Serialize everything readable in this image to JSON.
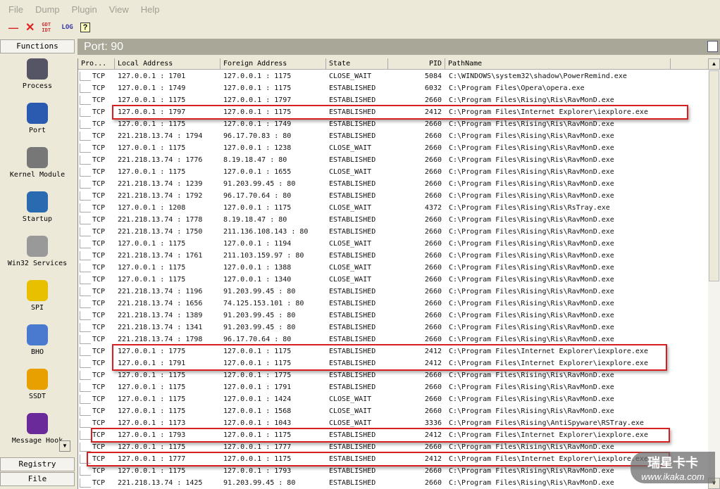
{
  "menu": [
    "File",
    "Dump",
    "Plugin",
    "View",
    "Help"
  ],
  "toolbar": {
    "minimize": "—",
    "close": "✕",
    "gdt_idt": "GDT IDT",
    "log": "LOG",
    "help": "?"
  },
  "sidebar": {
    "header": "Functions",
    "items": [
      "Process",
      "Port",
      "Kernel Module",
      "Startup",
      "Win32 Services",
      "SPI",
      "BHO",
      "SSDT",
      "Message Hook"
    ],
    "bottom": [
      "Registry",
      "File"
    ]
  },
  "title": "Port: 90",
  "columns": [
    "Pro...",
    "Local Address",
    "Foreign Address",
    "State",
    "PID",
    "PathName"
  ],
  "rows": [
    [
      "TCP",
      "127.0.0.1 : 1701",
      "127.0.0.1 : 1175",
      "CLOSE_WAIT",
      "5084",
      "C:\\WINDOWS\\system32\\shadow\\PowerRemind.exe"
    ],
    [
      "TCP",
      "127.0.0.1 : 1749",
      "127.0.0.1 : 1175",
      "ESTABLISHED",
      "6032",
      "C:\\Program Files\\Opera\\opera.exe"
    ],
    [
      "TCP",
      "127.0.0.1 : 1175",
      "127.0.0.1 : 1797",
      "ESTABLISHED",
      "2660",
      "C:\\Program Files\\Rising\\Ris\\RavMonD.exe"
    ],
    [
      "TCP",
      "127.0.0.1 : 1797",
      "127.0.0.1 : 1175",
      "ESTABLISHED",
      "2412",
      "C:\\Program Files\\Internet Explorer\\iexplore.exe"
    ],
    [
      "TCP",
      "127.0.0.1 : 1175",
      "127.0.0.1 : 1749",
      "ESTABLISHED",
      "2660",
      "C:\\Program Files\\Rising\\Ris\\RavMonD.exe"
    ],
    [
      "TCP",
      "221.218.13.74 : 1794",
      "96.17.70.83 : 80",
      "ESTABLISHED",
      "2660",
      "C:\\Program Files\\Rising\\Ris\\RavMonD.exe"
    ],
    [
      "TCP",
      "127.0.0.1 : 1175",
      "127.0.0.1 : 1238",
      "CLOSE_WAIT",
      "2660",
      "C:\\Program Files\\Rising\\Ris\\RavMonD.exe"
    ],
    [
      "TCP",
      "221.218.13.74 : 1776",
      "8.19.18.47 : 80",
      "ESTABLISHED",
      "2660",
      "C:\\Program Files\\Rising\\Ris\\RavMonD.exe"
    ],
    [
      "TCP",
      "127.0.0.1 : 1175",
      "127.0.0.1 : 1655",
      "CLOSE_WAIT",
      "2660",
      "C:\\Program Files\\Rising\\Ris\\RavMonD.exe"
    ],
    [
      "TCP",
      "221.218.13.74 : 1239",
      "91.203.99.45 : 80",
      "ESTABLISHED",
      "2660",
      "C:\\Program Files\\Rising\\Ris\\RavMonD.exe"
    ],
    [
      "TCP",
      "221.218.13.74 : 1792",
      "96.17.70.64 : 80",
      "ESTABLISHED",
      "2660",
      "C:\\Program Files\\Rising\\Ris\\RavMonD.exe"
    ],
    [
      "TCP",
      "127.0.0.1 : 1208",
      "127.0.0.1 : 1175",
      "CLOSE_WAIT",
      "4372",
      "C:\\Program Files\\Rising\\Ris\\RsTray.exe"
    ],
    [
      "TCP",
      "221.218.13.74 : 1778",
      "8.19.18.47 : 80",
      "ESTABLISHED",
      "2660",
      "C:\\Program Files\\Rising\\Ris\\RavMonD.exe"
    ],
    [
      "TCP",
      "221.218.13.74 : 1750",
      "211.136.108.143 : 80",
      "ESTABLISHED",
      "2660",
      "C:\\Program Files\\Rising\\Ris\\RavMonD.exe"
    ],
    [
      "TCP",
      "127.0.0.1 : 1175",
      "127.0.0.1 : 1194",
      "CLOSE_WAIT",
      "2660",
      "C:\\Program Files\\Rising\\Ris\\RavMonD.exe"
    ],
    [
      "TCP",
      "221.218.13.74 : 1761",
      "211.103.159.97 : 80",
      "ESTABLISHED",
      "2660",
      "C:\\Program Files\\Rising\\Ris\\RavMonD.exe"
    ],
    [
      "TCP",
      "127.0.0.1 : 1175",
      "127.0.0.1 : 1388",
      "CLOSE_WAIT",
      "2660",
      "C:\\Program Files\\Rising\\Ris\\RavMonD.exe"
    ],
    [
      "TCP",
      "127.0.0.1 : 1175",
      "127.0.0.1 : 1340",
      "CLOSE_WAIT",
      "2660",
      "C:\\Program Files\\Rising\\Ris\\RavMonD.exe"
    ],
    [
      "TCP",
      "221.218.13.74 : 1196",
      "91.203.99.45 : 80",
      "ESTABLISHED",
      "2660",
      "C:\\Program Files\\Rising\\Ris\\RavMonD.exe"
    ],
    [
      "TCP",
      "221.218.13.74 : 1656",
      "74.125.153.101 : 80",
      "ESTABLISHED",
      "2660",
      "C:\\Program Files\\Rising\\Ris\\RavMonD.exe"
    ],
    [
      "TCP",
      "221.218.13.74 : 1389",
      "91.203.99.45 : 80",
      "ESTABLISHED",
      "2660",
      "C:\\Program Files\\Rising\\Ris\\RavMonD.exe"
    ],
    [
      "TCP",
      "221.218.13.74 : 1341",
      "91.203.99.45 : 80",
      "ESTABLISHED",
      "2660",
      "C:\\Program Files\\Rising\\Ris\\RavMonD.exe"
    ],
    [
      "TCP",
      "221.218.13.74 : 1798",
      "96.17.70.64 : 80",
      "ESTABLISHED",
      "2660",
      "C:\\Program Files\\Rising\\Ris\\RavMonD.exe"
    ],
    [
      "TCP",
      "127.0.0.1 : 1775",
      "127.0.0.1 : 1175",
      "ESTABLISHED",
      "2412",
      "C:\\Program Files\\Internet Explorer\\iexplore.exe"
    ],
    [
      "TCP",
      "127.0.0.1 : 1791",
      "127.0.0.1 : 1175",
      "ESTABLISHED",
      "2412",
      "C:\\Program Files\\Internet Explorer\\iexplore.exe"
    ],
    [
      "TCP",
      "127.0.0.1 : 1175",
      "127.0.0.1 : 1775",
      "ESTABLISHED",
      "2660",
      "C:\\Program Files\\Rising\\Ris\\RavMonD.exe"
    ],
    [
      "TCP",
      "127.0.0.1 : 1175",
      "127.0.0.1 : 1791",
      "ESTABLISHED",
      "2660",
      "C:\\Program Files\\Rising\\Ris\\RavMonD.exe"
    ],
    [
      "TCP",
      "127.0.0.1 : 1175",
      "127.0.0.1 : 1424",
      "CLOSE_WAIT",
      "2660",
      "C:\\Program Files\\Rising\\Ris\\RavMonD.exe"
    ],
    [
      "TCP",
      "127.0.0.1 : 1175",
      "127.0.0.1 : 1568",
      "CLOSE_WAIT",
      "2660",
      "C:\\Program Files\\Rising\\Ris\\RavMonD.exe"
    ],
    [
      "TCP",
      "127.0.0.1 : 1173",
      "127.0.0.1 : 1043",
      "CLOSE_WAIT",
      "3336",
      "C:\\Program Files\\Rising\\AntiSpyware\\RSTray.exe"
    ],
    [
      "TCP",
      "127.0.0.1 : 1793",
      "127.0.0.1 : 1175",
      "ESTABLISHED",
      "2412",
      "C:\\Program Files\\Internet Explorer\\iexplore.exe"
    ],
    [
      "TCP",
      "127.0.0.1 : 1175",
      "127.0.0.1 : 1777",
      "ESTABLISHED",
      "2660",
      "C:\\Program Files\\Rising\\Ris\\RavMonD.exe"
    ],
    [
      "TCP",
      "127.0.0.1 : 1777",
      "127.0.0.1 : 1175",
      "ESTABLISHED",
      "2412",
      "C:\\Program Files\\Internet Explorer\\iexplore.exe"
    ],
    [
      "TCP",
      "127.0.0.1 : 1175",
      "127.0.0.1 : 1793",
      "ESTABLISHED",
      "2660",
      "C:\\Program Files\\Rising\\Ris\\RavMonD.exe"
    ],
    [
      "TCP",
      "221.218.13.74 : 1425",
      "91.203.99.45 : 80",
      "ESTABLISHED",
      "2660",
      "C:\\Program Files\\Rising\\Ris\\RavMonD.exe"
    ]
  ],
  "highlight_rows": [
    3,
    23,
    24,
    30,
    32
  ],
  "highlight_color": "#d42020",
  "watermark": {
    "brand": "瑞星卡卡",
    "url": "www.ikaka.com"
  }
}
